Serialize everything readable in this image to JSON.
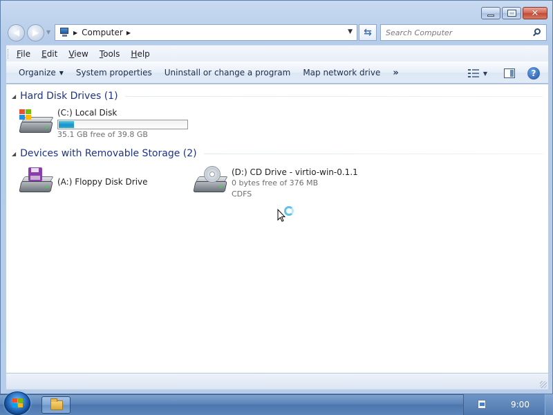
{
  "window": {
    "caption_buttons": [
      "minimize",
      "maximize",
      "close"
    ],
    "close_glyph": "✕"
  },
  "address": {
    "breadcrumb": [
      "Computer"
    ],
    "search_placeholder": "Search Computer"
  },
  "menu": {
    "items": [
      "File",
      "Edit",
      "View",
      "Tools",
      "Help"
    ]
  },
  "commands": {
    "organize": "Organize",
    "system_properties": "System properties",
    "uninstall": "Uninstall or change a program",
    "map_network_drive": "Map network drive",
    "more": "»",
    "help": "?"
  },
  "groups": [
    {
      "title": "Hard Disk Drives (1)",
      "drives": [
        {
          "name": "(C:) Local Disk",
          "detail": "35.1 GB free of 39.8 GB",
          "used_fraction": 0.118,
          "icon": "hard-disk-windows-icon"
        }
      ]
    },
    {
      "title": "Devices with Removable Storage (2)",
      "drives": [
        {
          "name": "(A:) Floppy Disk Drive",
          "icon": "floppy-drive-icon"
        },
        {
          "name": "(D:) CD Drive - virtio-win-0.1.1",
          "detail": "0 bytes free of 376 MB",
          "filesystem": "CDFS",
          "icon": "cd-drive-icon"
        }
      ]
    }
  ],
  "taskbar": {
    "clock": "9:00",
    "pinned": [
      "windows-explorer"
    ]
  },
  "colors": {
    "group_title": "#1e3287",
    "capacity_fill": "#26a3d6",
    "window_frame": "#b4cbe9"
  }
}
